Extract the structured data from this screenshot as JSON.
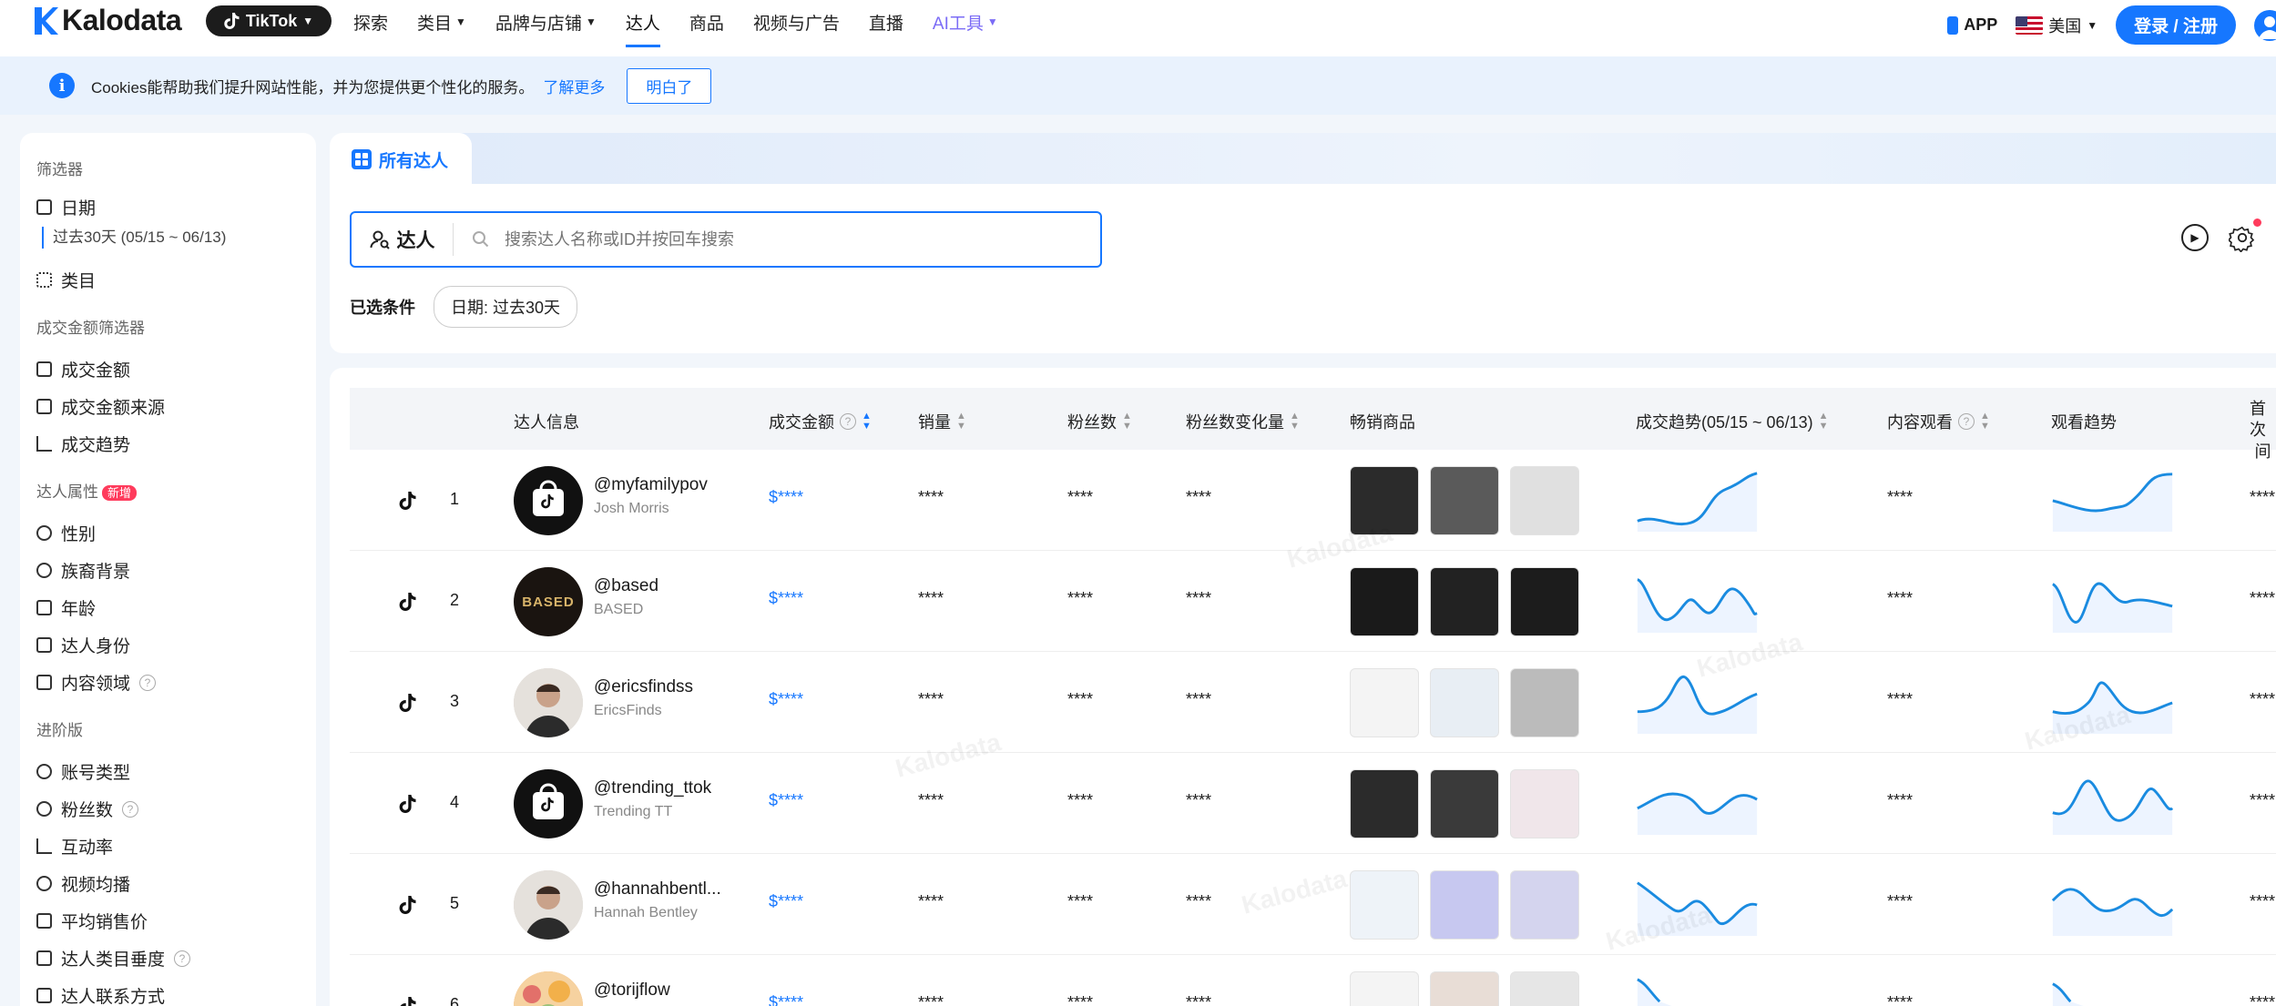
{
  "header": {
    "brand": "Kalodata",
    "platform": "TikTok",
    "nav": [
      {
        "label": "探索",
        "caret": false
      },
      {
        "label": "类目",
        "caret": true
      },
      {
        "label": "品牌与店铺",
        "caret": true
      },
      {
        "label": "达人",
        "caret": false,
        "active": true
      },
      {
        "label": "商品",
        "caret": false
      },
      {
        "label": "视频与广告",
        "caret": false
      },
      {
        "label": "直播",
        "caret": false
      },
      {
        "label": "AI工具",
        "caret": true
      }
    ],
    "app_label": "APP",
    "region": "美国",
    "login_label": "登录 / 注册"
  },
  "cookie_banner": {
    "text": "Cookies能帮助我们提升网站性能，并为您提供更个性化的服务。",
    "learn_more": "了解更多",
    "ok": "明白了"
  },
  "sidebar": {
    "filter_title": "筛选器",
    "date_label": "日期",
    "date_value": "过去30天 (05/15 ~ 06/13)",
    "category_label": "类目",
    "gmv_title": "成交金额筛选器",
    "gmv_items": [
      "成交金额",
      "成交金额来源",
      "成交趋势"
    ],
    "attr_title": "达人属性",
    "new_badge": "新增",
    "attr_items": [
      "性别",
      "族裔背景",
      "年龄",
      "达人身份",
      "内容领域"
    ],
    "adv_title": "进阶版",
    "adv_items": [
      "账号类型",
      "粉丝数",
      "互动率",
      "视频均播",
      "平均销售价",
      "达人类目垂度",
      "达人联系方式"
    ]
  },
  "main": {
    "tab_label": "所有达人",
    "search_type": "达人",
    "search_placeholder": "搜索达人名称或ID并按回车搜索",
    "selected_label": "已选条件",
    "chip": "日期: 过去30天"
  },
  "table": {
    "columns": [
      "达人信息",
      "成交金额",
      "销量",
      "粉丝数",
      "粉丝数变化量",
      "畅销商品",
      "成交趋势(05/15 ~ 06/13)",
      "内容观看",
      "观看趋势",
      "首次",
      "间"
    ],
    "masked": "****",
    "masked_money": "$****",
    "rows": [
      {
        "rank": "1",
        "handle": "@myfamilypov",
        "name": "Josh Morris",
        "avatar": "tiktok"
      },
      {
        "rank": "2",
        "handle": "@based",
        "name": "BASED",
        "avatar": "based"
      },
      {
        "rank": "3",
        "handle": "@ericsfindss",
        "name": "EricsFinds",
        "avatar": "person"
      },
      {
        "rank": "4",
        "handle": "@trending_ttok",
        "name": "Trending TT",
        "avatar": "tiktok"
      },
      {
        "rank": "5",
        "handle": "@hannahbentl...",
        "name": "Hannah Bentley",
        "avatar": "person"
      },
      {
        "rank": "6",
        "handle": "@torijflow",
        "name": "",
        "avatar": "floral"
      }
    ],
    "watermark": "Kalodata"
  },
  "colors": {
    "accent": "#1677ff",
    "trend_line": "#1a8be0",
    "badge": "#ff3b5c"
  }
}
